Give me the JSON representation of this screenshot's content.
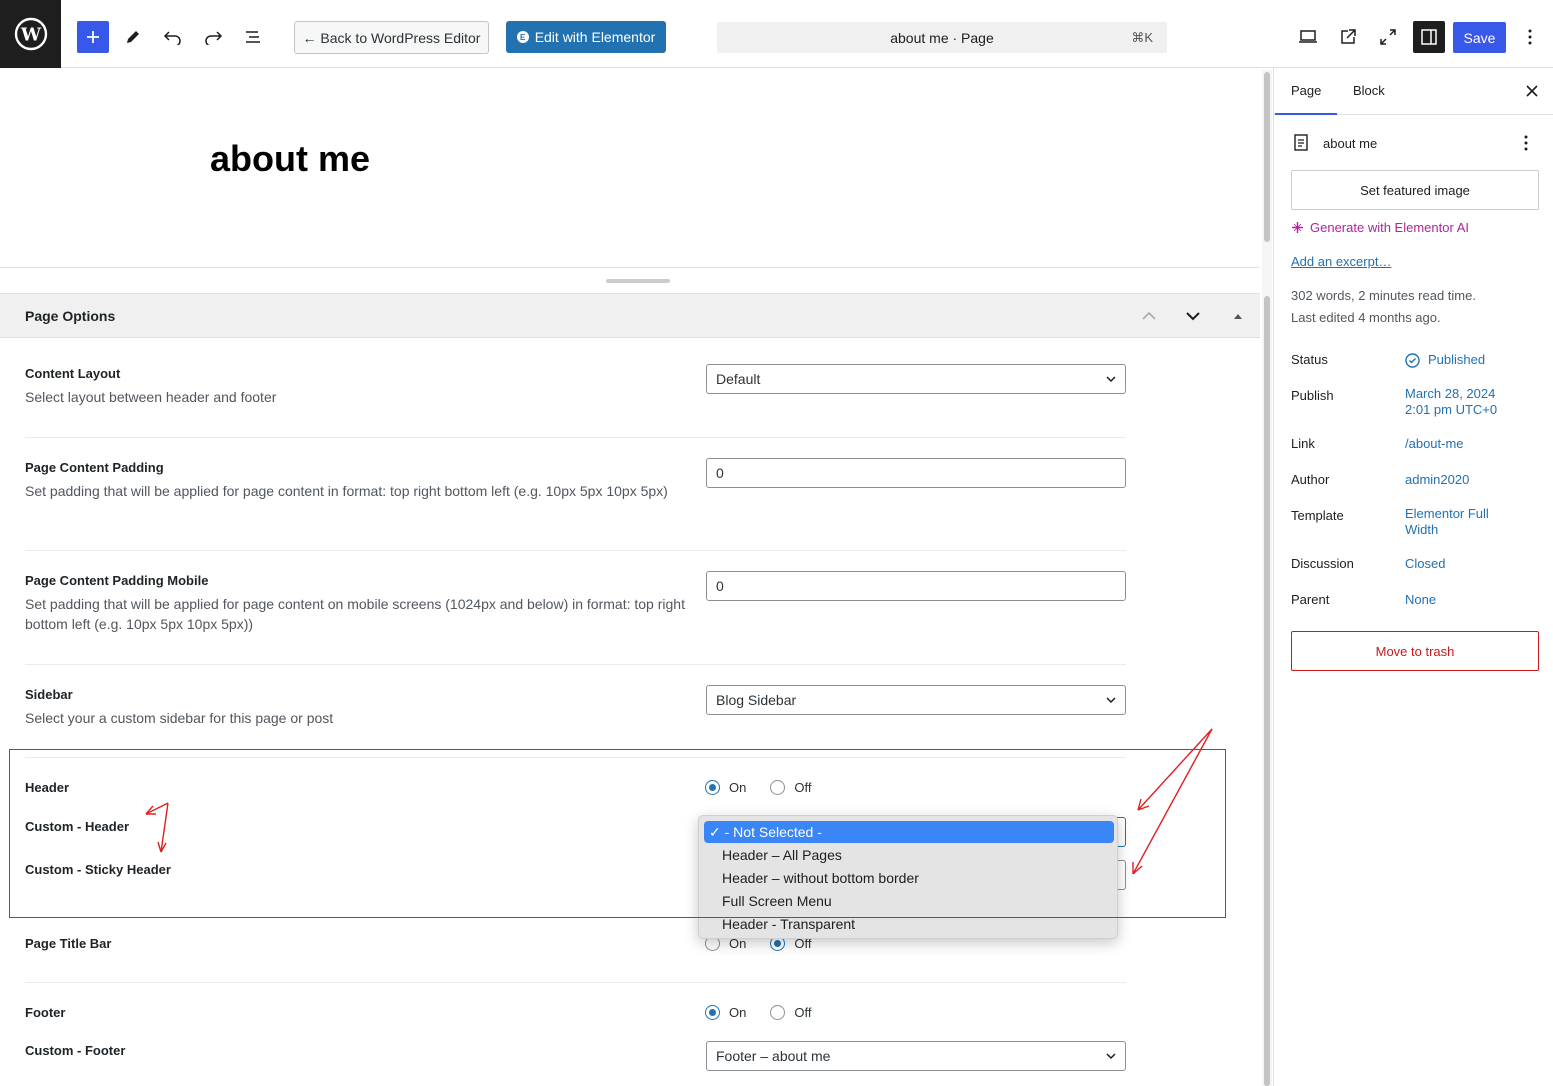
{
  "toolbar": {
    "back_label": "← Back to WordPress Editor",
    "elementor_label": "Edit with Elementor",
    "command_title": "about me · Page",
    "command_shortcut": "⌘K",
    "save_label": "Save"
  },
  "editor": {
    "page_title": "about me"
  },
  "page_options": {
    "title": "Page Options",
    "content_layout": {
      "label": "Content Layout",
      "desc": "Select layout between header and footer",
      "value": "Default"
    },
    "padding": {
      "label": "Page Content Padding",
      "desc": "Set padding that will be applied for page content in format: top right bottom left (e.g. 10px 5px 10px 5px)",
      "value": "0"
    },
    "padding_mobile": {
      "label": "Page Content Padding Mobile",
      "desc": "Set padding that will be applied for page content on mobile screens (1024px and below) in format: top right bottom left (e.g. 10px 5px 10px 5px))",
      "value": "0"
    },
    "sidebar": {
      "label": "Sidebar",
      "desc": "Select your a custom sidebar for this page or post",
      "value": "Blog Sidebar"
    },
    "header": {
      "label": "Header",
      "on": "On",
      "off": "Off"
    },
    "custom_header": {
      "label": "Custom - Header"
    },
    "custom_sticky": {
      "label": "Custom - Sticky Header"
    },
    "title_bar": {
      "label": "Page Title Bar",
      "on": "On",
      "off": "Off"
    },
    "footer": {
      "label": "Footer",
      "on": "On",
      "off": "Off"
    },
    "custom_footer": {
      "label": "Custom - Footer",
      "value": "Footer – about me"
    }
  },
  "dropdown": {
    "options": [
      "- Not Selected -",
      "Header – All Pages",
      "Header – without bottom border",
      "Full Screen Menu",
      "Header - Transparent"
    ],
    "check": "✓"
  },
  "sidebar": {
    "tab_page": "Page",
    "tab_block": "Block",
    "doc_title": "about me",
    "featured_label": "Set featured image",
    "ai_label": "Generate with Elementor AI",
    "excerpt_label": "Add an excerpt…",
    "words_info": "302 words, 2 minutes read time.",
    "edited_info": "Last edited 4 months ago.",
    "rows": [
      {
        "label": "Status",
        "value": "Published"
      },
      {
        "label": "Publish",
        "value": "March 28, 2024 2:01 pm UTC+0"
      },
      {
        "label": "Link",
        "value": "/about-me"
      },
      {
        "label": "Author",
        "value": "admin2020"
      },
      {
        "label": "Template",
        "value": "Elementor Full Width"
      },
      {
        "label": "Discussion",
        "value": "Closed"
      },
      {
        "label": "Parent",
        "value": "None"
      }
    ],
    "trash_label": "Move to trash"
  },
  "colors": {
    "accent": "#3858e9",
    "link": "#2271b1",
    "annotation": "#e02020",
    "danger": "#cc1818"
  }
}
